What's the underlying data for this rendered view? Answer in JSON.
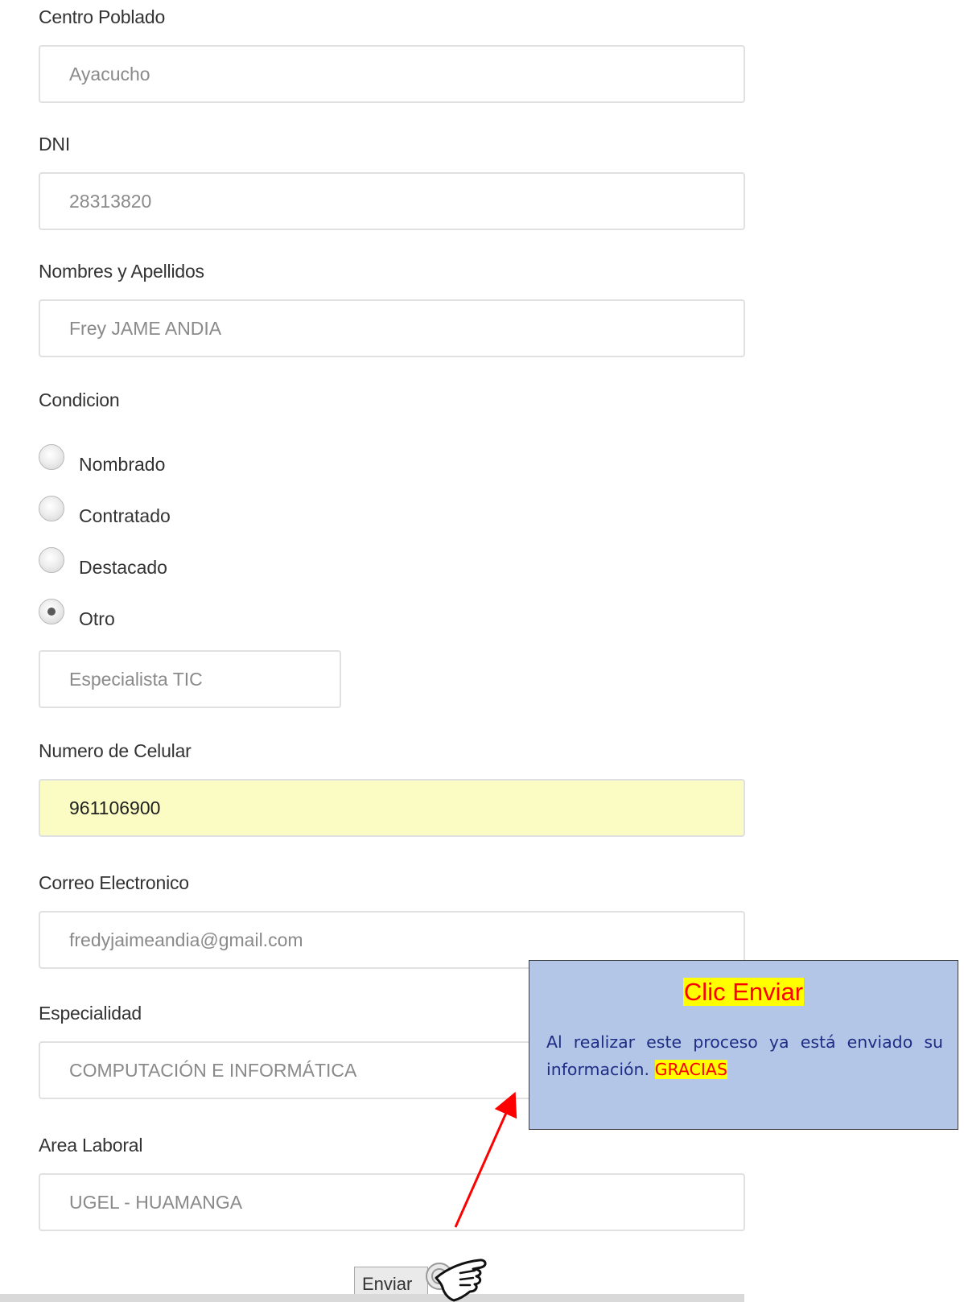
{
  "form": {
    "centro_poblado": {
      "label": "Centro Poblado",
      "value": "Ayacucho"
    },
    "dni": {
      "label": "DNI",
      "value": "28313820"
    },
    "nombres": {
      "label": "Nombres y Apellidos",
      "value": "Frey JAME ANDIA"
    },
    "condicion": {
      "label": "Condicion",
      "options": [
        {
          "label": "Nombrado",
          "checked": false
        },
        {
          "label": "Contratado",
          "checked": false
        },
        {
          "label": "Destacado",
          "checked": false
        },
        {
          "label": "Otro",
          "checked": true
        }
      ],
      "otro_value": "Especialista TIC"
    },
    "celular": {
      "label": "Numero de Celular",
      "value": "961106900",
      "highlight_color": "#fafcc3"
    },
    "correo": {
      "label": "Correo Electronico",
      "value": "fredyjaimeandia@gmail.com"
    },
    "especialidad": {
      "label": "Especialidad",
      "value": "COMPUTACIÓN E INFORMÁTICA"
    },
    "area_laboral": {
      "label": "Area Laboral",
      "value": "UGEL - HUAMANGA"
    },
    "submit_label": "Enviar"
  },
  "callout": {
    "title": "Clic Enviar",
    "body": "Al realizar este proceso ya está enviado su información.",
    "highlight": "GRACIAS",
    "background": "#b4c6e7",
    "text_color": "#1f2d84",
    "highlight_color": "#ffff00",
    "accent_color": "#ff0000"
  },
  "annotations": {
    "arrow_icon": "red-arrow-icon",
    "pointer_icon": "hand-pointer-icon"
  }
}
